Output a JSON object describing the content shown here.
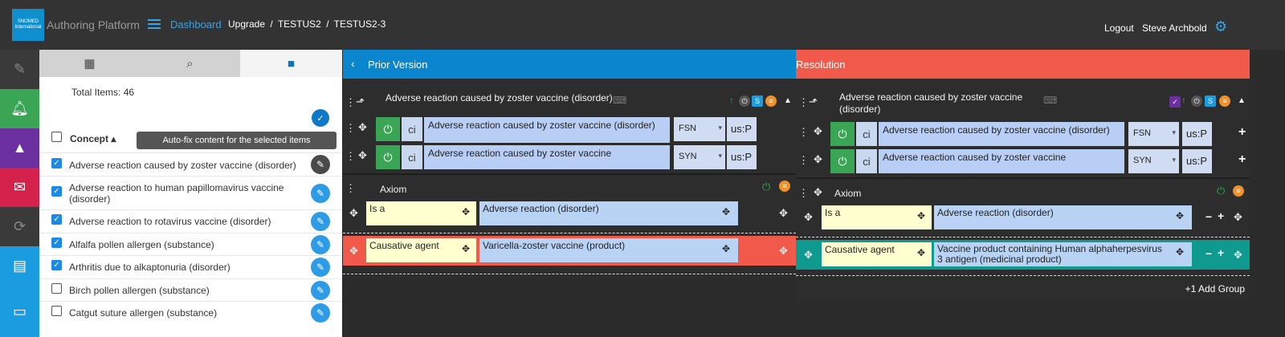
{
  "header": {
    "logo_text": "SNOMED International",
    "app_title": "Authoring Platform",
    "dashboard": "Dashboard",
    "breadcrumbs": [
      "Upgrade",
      "/",
      "TESTUS2",
      "/",
      "TESTUS2-3"
    ],
    "logout": "Logout",
    "user": "Steve Archbold"
  },
  "left_panel": {
    "total_items": "Total Items: 46",
    "tooltip": "Auto-fix content for the selected items",
    "column_header": "Concept ▴",
    "rows": [
      {
        "label": "Adverse reaction caused by zoster vaccine (disorder)",
        "checked": true
      },
      {
        "label": "Adverse reaction to human papillomavirus vaccine (disorder)",
        "checked": true
      },
      {
        "label": "Adverse reaction to rotavirus vaccine (disorder)",
        "checked": true
      },
      {
        "label": "Alfalfa pollen allergen (substance)",
        "checked": true
      },
      {
        "label": "Arthritis due to alkaptonuria (disorder)",
        "checked": true
      },
      {
        "label": "Birch pollen allergen (substance)",
        "checked": false
      },
      {
        "label": "Catgut suture allergen (substance)",
        "checked": false
      }
    ]
  },
  "prior": {
    "header": "Prior Version",
    "back_glyph": "‹",
    "concept_title": "Adverse reaction caused by zoster vaccine (disorder)",
    "descriptions": [
      {
        "term": "Adverse reaction caused by zoster vaccine (disorder)",
        "type": "FSN",
        "ci": "ci",
        "lang": "us:P"
      },
      {
        "term": "Adverse reaction caused by zoster vaccine",
        "type": "SYN",
        "ci": "ci",
        "lang": "us:P"
      }
    ],
    "axiom_label": "Axiom",
    "relationships": [
      {
        "attr": "Is a",
        "value": "Adverse reaction (disorder)"
      },
      {
        "attr": "Causative agent",
        "value": "Varicella-zoster vaccine (product)"
      }
    ]
  },
  "resolution": {
    "header": "Resolution",
    "concept_title": "Adverse reaction caused by zoster vaccine (disorder)",
    "descriptions": [
      {
        "term": "Adverse reaction caused by zoster vaccine (disorder)",
        "type": "FSN",
        "ci": "ci",
        "lang": "us:P"
      },
      {
        "term": "Adverse reaction caused by zoster vaccine",
        "type": "SYN",
        "ci": "ci",
        "lang": "us:P"
      }
    ],
    "axiom_label": "Axiom",
    "relationships": [
      {
        "attr": "Is a",
        "value": "Adverse reaction (disorder)"
      },
      {
        "attr": "Causative agent",
        "value": "Vaccine product containing Human alphaherpesvirus 3 antigen (medicinal product)"
      }
    ],
    "add_group": "+1 Add Group"
  },
  "colors": {
    "accent": "#0a86cf",
    "resolution": "#f15a4b",
    "nav_edit": "#3a3a3a",
    "nav_bell": "#3aa655",
    "nav_edu": "#6b2fa0",
    "nav_mail": "#d4224d",
    "nav_sync": "#3a3a3a",
    "nav_list": "#1b9ce0",
    "nav_panel": "#1b9ce0"
  }
}
